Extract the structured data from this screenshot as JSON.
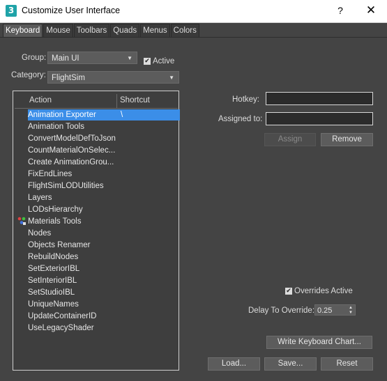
{
  "window": {
    "icon_glyph": "3",
    "title": "Customize User Interface",
    "help": "?",
    "close": "✕"
  },
  "tabs": [
    "Keyboard",
    "Mouse",
    "Toolbars",
    "Quads",
    "Menus",
    "Colors"
  ],
  "group": {
    "label": "Group:",
    "value": "Main UI"
  },
  "active": {
    "label": "Active",
    "checked": true
  },
  "category": {
    "label": "Category:",
    "value": "FlightSim"
  },
  "list": {
    "col_action": "Action",
    "col_shortcut": "Shortcut",
    "items": [
      "Animation Exporter",
      "Animation Tools",
      "ConvertModelDefToJson",
      "CountMaterialOnSelec...",
      "Create AnimationGrou...",
      "FixEndLines",
      "FlightSimLODUtilities",
      "Layers",
      "LODsHierarchy",
      "Materials Tools",
      "Nodes",
      "Objects Renamer",
      "RebuildNodes",
      "SetExteriorIBL",
      "SetInteriorIBL",
      "SetStudioIBL",
      "UniqueNames",
      "UpdateContainerID",
      "UseLegacyShader"
    ],
    "selected_shortcut": "\\"
  },
  "hotkey": {
    "label": "Hotkey:",
    "value": ""
  },
  "assigned": {
    "label": "Assigned to:",
    "value": ""
  },
  "buttons": {
    "assign": "Assign",
    "remove": "Remove",
    "write_chart": "Write Keyboard Chart...",
    "load": "Load...",
    "save": "Save...",
    "reset": "Reset"
  },
  "overrides": {
    "label": "Overrides Active",
    "checked": true
  },
  "delay": {
    "label": "Delay To Override:",
    "value": "0.25"
  }
}
